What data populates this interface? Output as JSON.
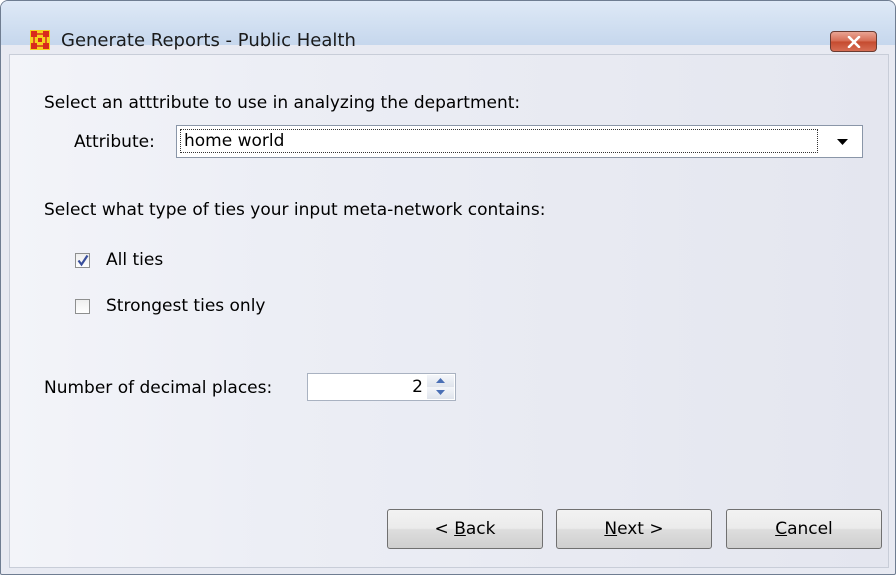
{
  "window": {
    "title": "Generate Reports - Public Health",
    "icon": "network-app-icon",
    "close_icon": "close-icon"
  },
  "attribute_section": {
    "prompt": "Select an atttribute to use in analyzing the department:",
    "field_label": "Attribute:",
    "selected_value": "home world"
  },
  "ties_section": {
    "prompt": "Select what type of ties your input meta-network contains:",
    "options": [
      {
        "label": "All ties",
        "checked": true
      },
      {
        "label": "Strongest ties only",
        "checked": false
      }
    ]
  },
  "decimal_places": {
    "label": "Number of decimal places:",
    "value": "2"
  },
  "buttons": {
    "back": {
      "prefix": "< ",
      "mnemonic": "B",
      "rest": "ack"
    },
    "next": {
      "mnemonic": "N",
      "rest": "ext >"
    },
    "cancel": {
      "mnemonic": "C",
      "rest": "ancel"
    }
  },
  "colors": {
    "titlebar": "#d3e1f2",
    "close_button": "#d56a51",
    "dialog_background": "#e8eaf2",
    "checkmark": "#3a4f9c"
  }
}
